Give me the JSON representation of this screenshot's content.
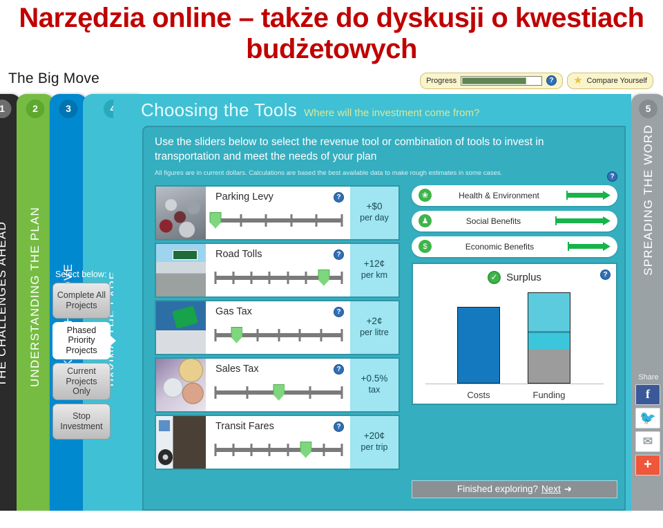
{
  "slide": {
    "title": "Narzędzia online – także do dyskusji o kwestiach budżetowych",
    "title_color": "#C00000"
  },
  "app": {
    "title": "The Big Move",
    "progress": {
      "label": "Progress",
      "percent": 80,
      "help_icon": "help-circle-icon"
    },
    "compare": {
      "label": "Compare Yourself",
      "icon": "star-icon"
    }
  },
  "steps": [
    {
      "num": "1",
      "label": "THE CHALLENGES AHEAD",
      "color": "#2b2b2b"
    },
    {
      "num": "2",
      "label": "UNDERSTANDING THE PLAN",
      "color": "#76BC43"
    },
    {
      "num": "3",
      "label": "MAKING THE MOVE",
      "color": "#0089CF"
    },
    {
      "num": "4",
      "label": "PAYING THE FARE",
      "color": "#3FC0D4"
    },
    {
      "num": "5",
      "label": "SPREADING THE WORD",
      "color": "#9AA2A6"
    }
  ],
  "share": {
    "label": "Share",
    "icons": [
      {
        "name": "facebook-icon",
        "glyph": "f"
      },
      {
        "name": "twitter-icon",
        "glyph": "▶"
      },
      {
        "name": "email-icon",
        "glyph": "✉"
      },
      {
        "name": "addthis-plus-icon",
        "glyph": "+"
      }
    ]
  },
  "content": {
    "heading": "Choosing the Tools",
    "subheading": "Where will the investment come from?",
    "instruction": "Use the sliders below to select the revenue tool or combination of tools to invest in transportation and meet the needs of your plan",
    "footnote": "All figures are in current dollars. Calculations are based the best available data to make rough estimates in some cases.",
    "panel_help_icon": "help-circle-icon"
  },
  "select_panel": {
    "title": "Select below:",
    "options": [
      {
        "label": "Complete All Projects",
        "active": false
      },
      {
        "label": "Phased Priority Projects",
        "active": true
      },
      {
        "label": "Current Projects Only",
        "active": false
      },
      {
        "label": "Stop Investment",
        "active": false
      }
    ]
  },
  "sliders": [
    {
      "name": "parking-levy",
      "label": "Parking Levy",
      "thumbnail": "parking-lot-cars-photo",
      "art_class": "art-cars",
      "ticks": 6,
      "value_index": 0,
      "value": "+$0",
      "unit": "per day",
      "help_icon": "help-circle-icon"
    },
    {
      "name": "road-tolls",
      "label": "Road Tolls",
      "thumbnail": "highway-traffic-photo",
      "art_class": "art-tolls",
      "ticks": 8,
      "value_index": 6,
      "value": "+12¢",
      "unit": "per km",
      "help_icon": "help-circle-icon"
    },
    {
      "name": "gas-tax",
      "label": "Gas Tax",
      "thumbnail": "fuel-pump-photo",
      "art_class": "art-gas",
      "ticks": 7,
      "value_index": 1,
      "value": "+2¢",
      "unit": "per litre",
      "help_icon": "help-circle-icon"
    },
    {
      "name": "sales-tax",
      "label": "Sales Tax",
      "thumbnail": "coins-and-banknotes-photo",
      "art_class": "art-coins",
      "ticks": 5,
      "value_index": 2,
      "value": "+0.5%",
      "unit": "tax",
      "help_icon": "help-circle-icon"
    },
    {
      "name": "transit-fares",
      "label": "Transit Fares",
      "thumbnail": "bus-boarding-photo",
      "art_class": "art-transit",
      "ticks": 8,
      "value_index": 5,
      "value": "+20¢",
      "unit": "per trip",
      "help_icon": "help-circle-icon"
    }
  ],
  "benefits": [
    {
      "name": "health-environment",
      "label": "Health & Environment",
      "icon": "leaf-circle-icon",
      "glyph": "❀",
      "arrow_length": 64
    },
    {
      "name": "social-benefits",
      "label": "Social Benefits",
      "icon": "people-circle-icon",
      "glyph": "♟",
      "arrow_length": 80
    },
    {
      "name": "economic-benefits",
      "label": "Economic Benefits",
      "icon": "dollar-circle-icon",
      "glyph": "$",
      "arrow_length": 62
    }
  ],
  "chart_data": {
    "type": "bar",
    "title": "Surplus",
    "status_icon": "check-circle-icon",
    "help_icon": "help-circle-icon",
    "categories": [
      "Costs",
      "Funding"
    ],
    "xlabel": "",
    "ylabel": "",
    "ylim": [
      0,
      100
    ],
    "grid": false,
    "legend": "none",
    "bars": [
      {
        "category": "Costs",
        "total": 84,
        "segments": [
          {
            "name": "costs",
            "value": 84,
            "color": "#1479BE"
          }
        ]
      },
      {
        "category": "Funding",
        "total": 100,
        "segments": [
          {
            "name": "existing-funding",
            "value": 37,
            "color": "#9C9C9C"
          },
          {
            "name": "new-revenue-tools",
            "value": 18,
            "color": "#3CC6DB"
          },
          {
            "name": "divider",
            "value": 2,
            "color": "#2E96A7"
          },
          {
            "name": "surplus",
            "value": 43,
            "color": "#5BCBDD"
          }
        ]
      }
    ]
  },
  "next_bar": {
    "prompt": "Finished exploring?",
    "link": "Next",
    "arrow": "➜"
  }
}
